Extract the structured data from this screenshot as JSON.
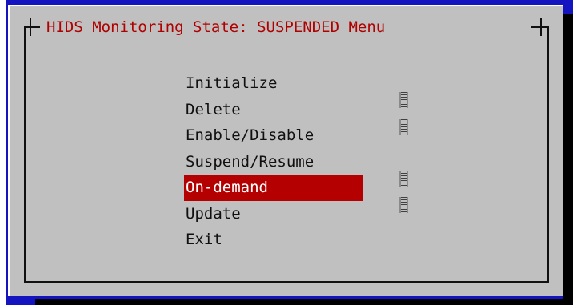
{
  "dialog": {
    "title": "HIDS Monitoring State: SUSPENDED Menu",
    "selected_index": 4,
    "items": [
      {
        "label": "Initialize",
        "marked": false
      },
      {
        "label": "Delete",
        "marked": true
      },
      {
        "label": "Enable/Disable",
        "marked": true
      },
      {
        "label": "Suspend/Resume",
        "marked": false
      },
      {
        "label": "On-demand",
        "marked": true
      },
      {
        "label": "Update",
        "marked": true
      },
      {
        "label": "Exit",
        "marked": false
      }
    ]
  },
  "colors": {
    "background": "#1414c0",
    "dialog": "#c0c0c0",
    "title_text": "#b00000",
    "highlight": "#b40000"
  },
  "icons": {
    "scroll_mark": "scroll-marker-icon"
  }
}
